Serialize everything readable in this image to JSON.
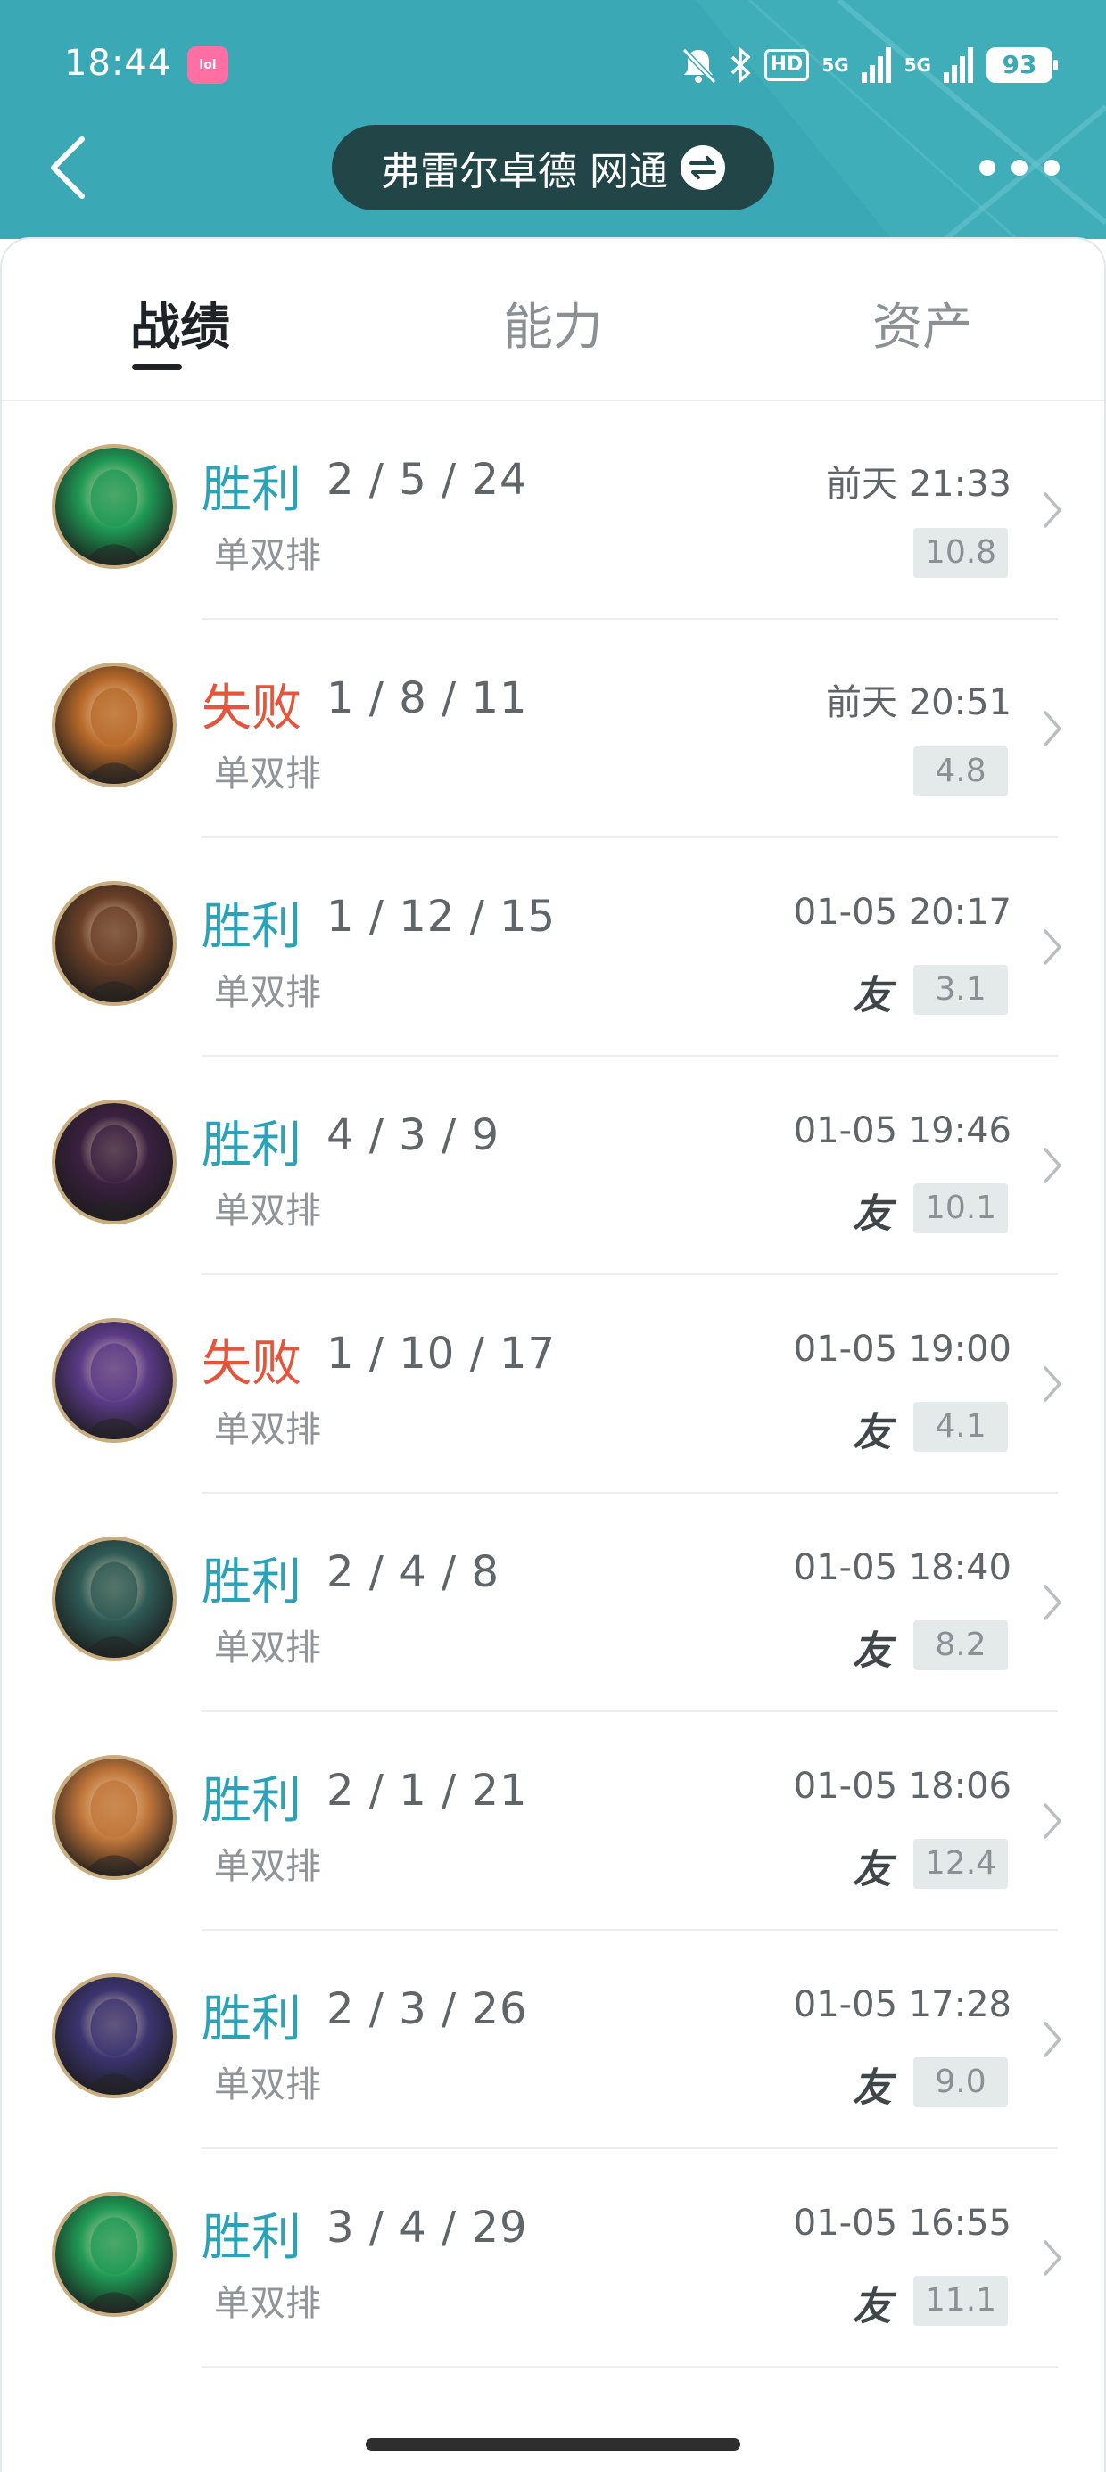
{
  "status_bar": {
    "time": "18:44",
    "app_badge": "lol",
    "hd_label": "HD",
    "signal_1": "5G",
    "signal_2": "5G",
    "battery": "93"
  },
  "header": {
    "title": "弗雷尔卓德 网通",
    "icons": [
      "back-chevron-icon",
      "swap-icon",
      "more-dots-icon"
    ]
  },
  "tabs": [
    {
      "label": "战绩",
      "active": true
    },
    {
      "label": "能力",
      "active": false
    },
    {
      "label": "资产",
      "active": false
    }
  ],
  "matches": [
    {
      "result": "胜利",
      "outcome": "win",
      "kda": "2 / 5 / 24",
      "mode": "单双排",
      "time": "前天 21:33",
      "friend": "",
      "score": "10.8",
      "avatar_color": "#1f9a55"
    },
    {
      "result": "失败",
      "outcome": "loss",
      "kda": "1 / 8 / 11",
      "mode": "单双排",
      "time": "前天 20:51",
      "friend": "",
      "score": "4.8",
      "avatar_color": "#b86a2a"
    },
    {
      "result": "胜利",
      "outcome": "win",
      "kda": "1 / 12 / 15",
      "mode": "单双排",
      "time": "01-05 20:17",
      "friend": "友",
      "score": "3.1",
      "avatar_color": "#6a4028"
    },
    {
      "result": "胜利",
      "outcome": "win",
      "kda": "4 / 3 / 9",
      "mode": "单双排",
      "time": "01-05 19:46",
      "friend": "友",
      "score": "10.1",
      "avatar_color": "#3a2040"
    },
    {
      "result": "失败",
      "outcome": "loss",
      "kda": "1 / 10 / 17",
      "mode": "单双排",
      "time": "01-05 19:00",
      "friend": "友",
      "score": "4.1",
      "avatar_color": "#5a3a86"
    },
    {
      "result": "胜利",
      "outcome": "win",
      "kda": "2 / 4 / 8",
      "mode": "单双排",
      "time": "01-05 18:40",
      "friend": "友",
      "score": "8.2",
      "avatar_color": "#2e5a55"
    },
    {
      "result": "胜利",
      "outcome": "win",
      "kda": "2 / 1 / 21",
      "mode": "单双排",
      "time": "01-05 18:06",
      "friend": "友",
      "score": "12.4",
      "avatar_color": "#c0763a"
    },
    {
      "result": "胜利",
      "outcome": "win",
      "kda": "2 / 3 / 26",
      "mode": "单双排",
      "time": "01-05 17:28",
      "friend": "友",
      "score": "9.0",
      "avatar_color": "#3c3470"
    },
    {
      "result": "胜利",
      "outcome": "win",
      "kda": "3 / 4 / 29",
      "mode": "单双排",
      "time": "01-05 16:55",
      "friend": "友",
      "score": "11.1",
      "avatar_color": "#1f9a55"
    }
  ],
  "colors": {
    "header_bg": "#3ba9b5",
    "win": "#2aa3b9",
    "loss": "#e5553b"
  }
}
